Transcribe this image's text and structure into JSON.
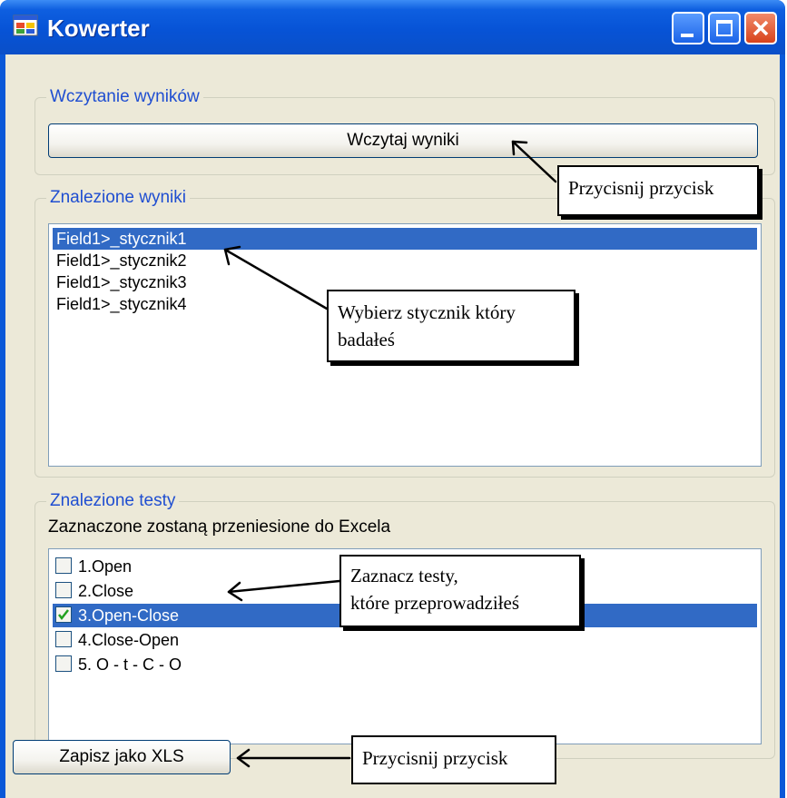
{
  "window": {
    "title": "Kowerter"
  },
  "load_group": {
    "title": "Wczytanie wyników",
    "load_button_label": "Wczytaj wyniki"
  },
  "results_group": {
    "title": "Znalezione wyniki",
    "items": [
      {
        "label": "Field1>_stycznik1",
        "selected": true
      },
      {
        "label": "Field1>_stycznik2",
        "selected": false
      },
      {
        "label": "Field1>_stycznik3",
        "selected": false
      },
      {
        "label": "Field1>_stycznik4",
        "selected": false
      }
    ]
  },
  "tests_group": {
    "title": "Znalezione testy",
    "subtitle": "Zaznaczone zostaną przeniesione do Excela",
    "items": [
      {
        "label": "1.Open",
        "checked": false,
        "selected": false
      },
      {
        "label": "2.Close",
        "checked": false,
        "selected": false
      },
      {
        "label": "3.Open-Close",
        "checked": true,
        "selected": true
      },
      {
        "label": "4.Close-Open",
        "checked": false,
        "selected": false
      },
      {
        "label": "5. O - t - C - O",
        "checked": false,
        "selected": false
      }
    ]
  },
  "footer": {
    "save_button_label": "Zapisz jako XLS"
  },
  "callouts": {
    "load_hint": "Przycisnij przycisk",
    "select_contact_line1": "Wybierz stycznik który",
    "select_contact_line2": "badałeś",
    "tests_hint_line1": "Zaznacz testy,",
    "tests_hint_line2": "które przeprowadziłeś",
    "save_hint": "Przycisnij przycisk"
  },
  "colors": {
    "titlebar": "#0753d6",
    "selection": "#316ac5",
    "group_title": "#1f4ed1",
    "client_bg": "#ece9d8"
  }
}
